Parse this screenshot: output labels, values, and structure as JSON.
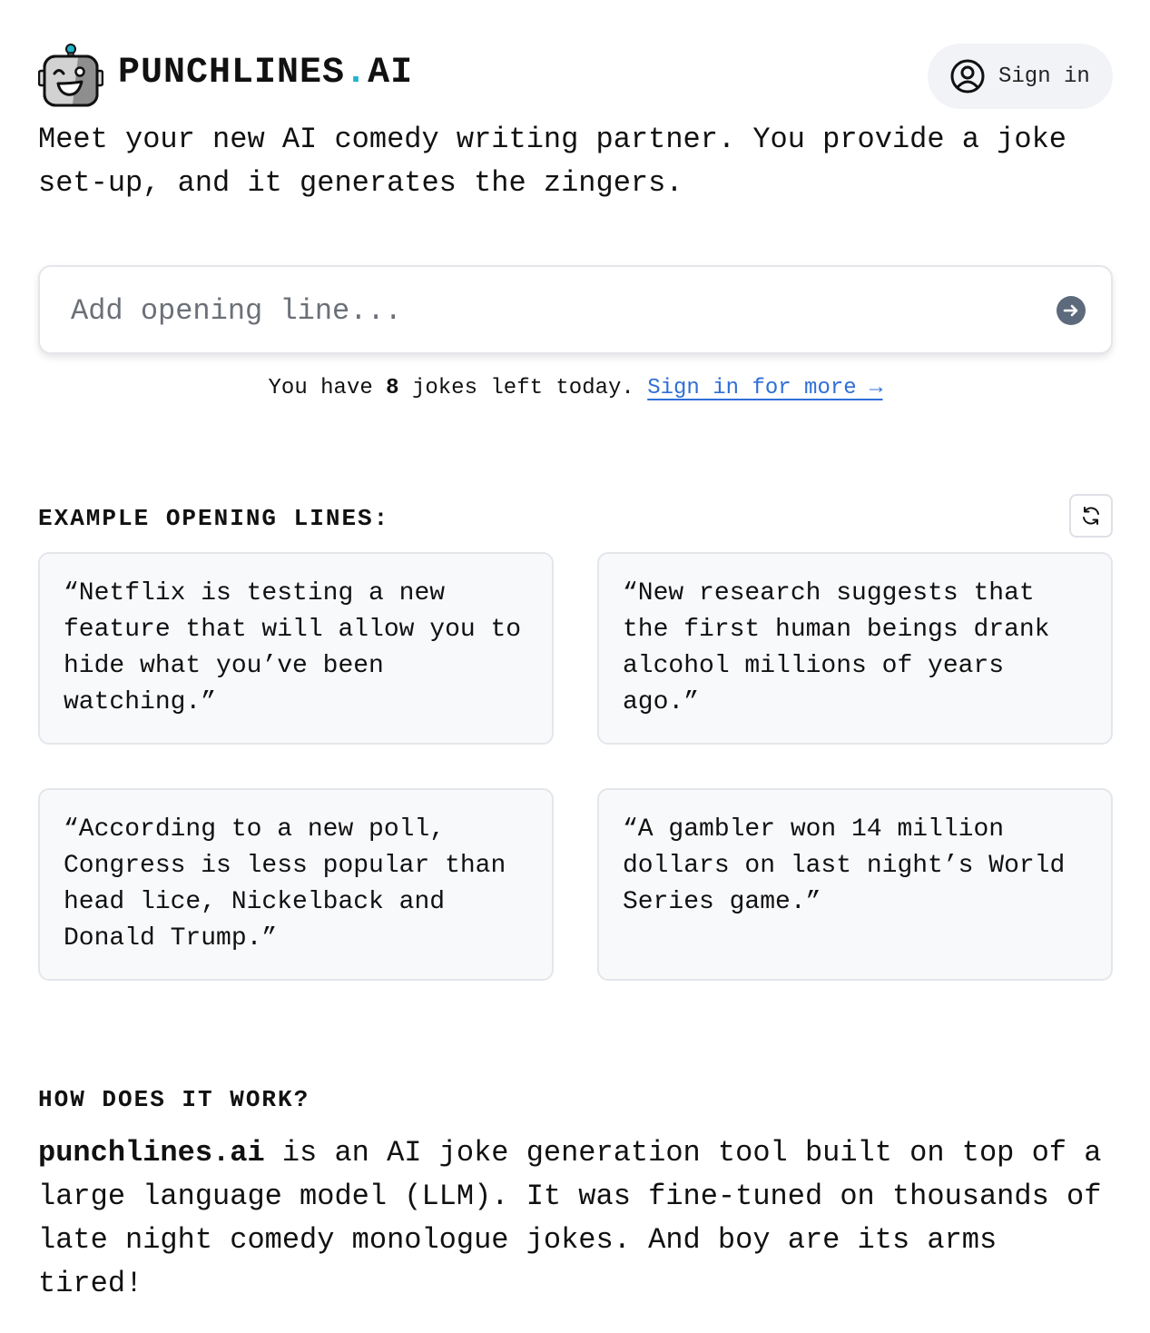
{
  "header": {
    "logo_name": "PUNCHLINES",
    "logo_dot": ".",
    "logo_suffix": "AI",
    "signin_label": "Sign in"
  },
  "tagline": "Meet your new AI comedy writing partner. You provide a joke set-up, and it generates the zingers.",
  "prompt": {
    "placeholder": "Add opening line...",
    "value": ""
  },
  "quota": {
    "prefix": "You have",
    "count": "8",
    "suffix": "jokes left today.",
    "link": "Sign in for more →"
  },
  "examples": {
    "heading": "EXAMPLE OPENING LINES:",
    "items": [
      "“Netflix is testing a new feature that will allow you to hide what you’ve been watching.”",
      "“New research suggests that the first human beings drank alcohol millions of years ago.”",
      "“According to a new poll, Congress is less popular than head lice, Nickelback and Donald Trump.”",
      "“A gambler won 14 million dollars on last night’s World Series game.”"
    ]
  },
  "how": {
    "heading": "HOW DOES IT WORK?",
    "brand": "punchlines.ai",
    "body": "is an AI joke generation tool built on top of a large language model (LLM). It was fine-tuned on thousands of late night comedy monologue jokes. And boy are its arms tired!"
  },
  "icons": {
    "logo": "robot-icon",
    "signin": "user-circle-icon",
    "submit": "arrow-right-icon",
    "refresh": "refresh-icon"
  },
  "colors": {
    "accent": "#1fb5c9",
    "link": "#2f6fd6",
    "submit": "#5d6a7b"
  }
}
